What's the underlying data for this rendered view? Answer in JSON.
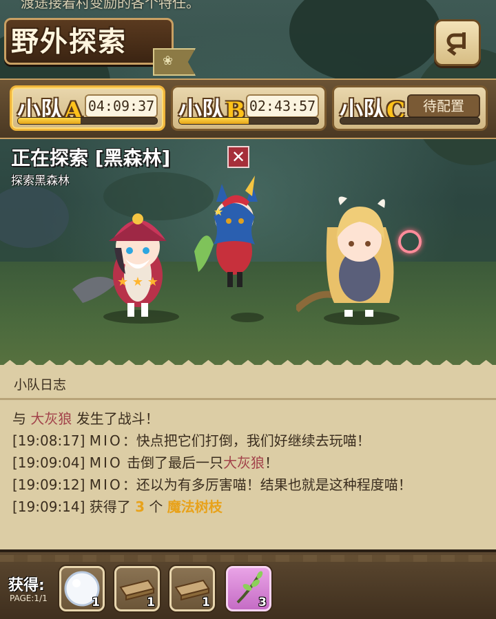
{
  "top_message": "渡途接着村变励的各个特任。",
  "title": "野外探索",
  "teams": [
    {
      "name": "小队",
      "letter": "A",
      "time": "04:09:37",
      "progress": 0.45,
      "active": true
    },
    {
      "name": "小队",
      "letter": "B",
      "time": "02:43:57",
      "progress": 0.5,
      "active": false
    },
    {
      "name": "小队",
      "letter": "C",
      "status": "待配置",
      "progress": 0.0,
      "active": false
    }
  ],
  "exploring": {
    "title": "正在探索 [黑森林]",
    "subtitle": "探索黑森林"
  },
  "log": {
    "header": "小队日志",
    "lines": [
      {
        "a": "与 ",
        "enemy": "大灰狼",
        "b": " 发生了战斗！"
      },
      {
        "time": "[19:08:17]",
        "name": "MIO",
        "text": "：快点把它们打倒，我们好继续去玩喵！"
      },
      {
        "time": "[19:09:04]",
        "name": "MIO",
        "text": " 击倒了最后一只",
        "enemy": "大灰狼",
        "end": "！"
      },
      {
        "time": "[19:09:12]",
        "name": "MIO",
        "text": "：还以为有多厉害喵！结果也就是这种程度喵！"
      },
      {
        "time": "[19:09:14]",
        "text": " 获得了 ",
        "count": "3",
        "mid": " 个 ",
        "item": "魔法树枝"
      }
    ]
  },
  "rewards": {
    "label": "获得:",
    "page": "PAGE:1/1",
    "items": [
      {
        "icon": "snowball-icon",
        "count": "1"
      },
      {
        "icon": "wood-plank-icon",
        "count": "1"
      },
      {
        "icon": "wood-plank-icon",
        "count": "1"
      },
      {
        "icon": "magic-branch-icon",
        "count": "3",
        "rare": true
      }
    ]
  },
  "colors": {
    "accent": "#ffc21a",
    "enemy": "#a2424a",
    "item": "#e8a21a",
    "rare_slot": "#d98ad6"
  }
}
